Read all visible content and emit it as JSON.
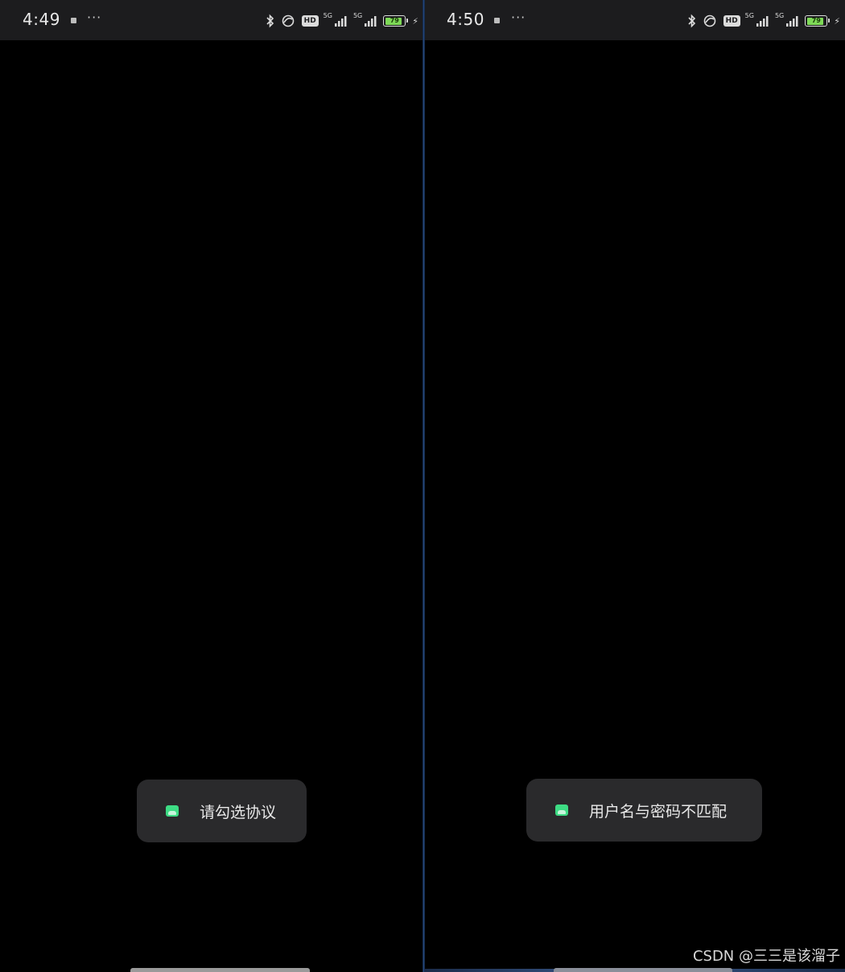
{
  "screens": [
    {
      "status_bar": {
        "time": "4:49",
        "more_dots": "···",
        "hd_label": "HD",
        "network_1": "5G",
        "network_2": "5G",
        "battery_level": "79"
      },
      "toast": {
        "message": "请勾选协议"
      }
    },
    {
      "status_bar": {
        "time": "4:50",
        "more_dots": "···",
        "hd_label": "HD",
        "network_1": "5G",
        "network_2": "5G",
        "battery_level": "79"
      },
      "toast": {
        "message": "用户名与密码不匹配"
      }
    }
  ],
  "watermark": "CSDN @三三是该溜子",
  "colors": {
    "status_bar_bg": "#1c1c1e",
    "screen_bg": "#000000",
    "toast_bg": "#2a2a2c",
    "toast_icon": "#3ddc84",
    "battery_fill": "#7ed957"
  }
}
